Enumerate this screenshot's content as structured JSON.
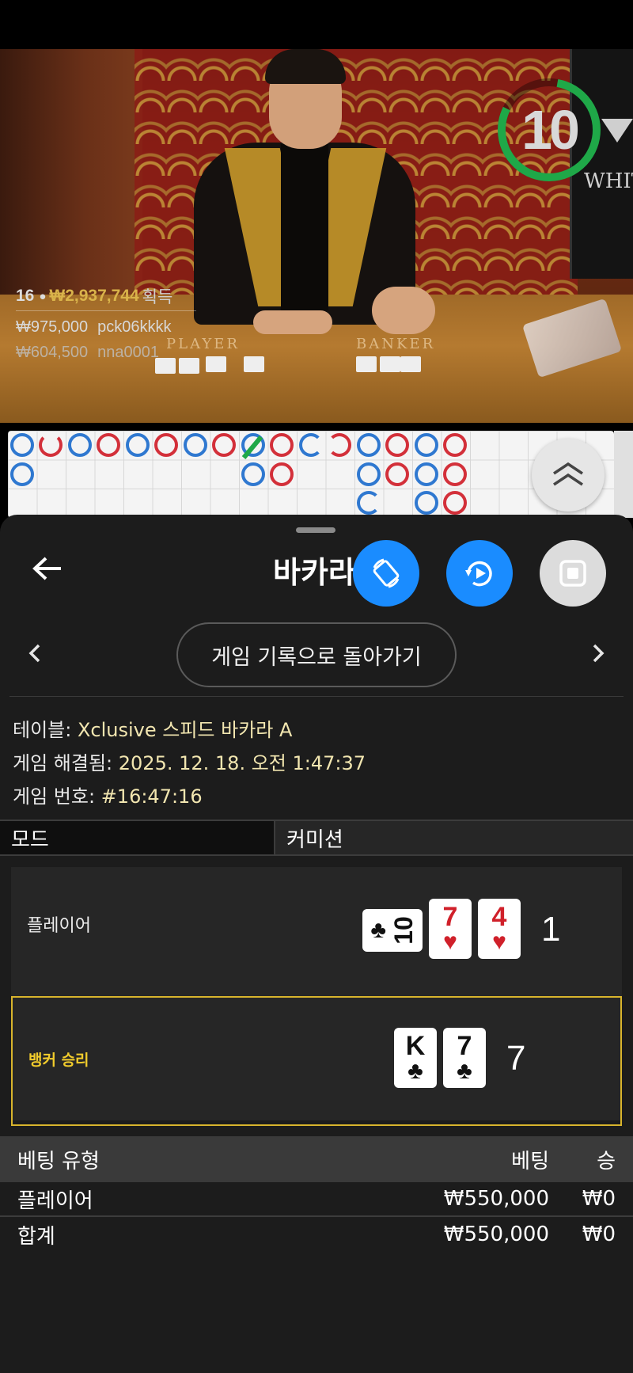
{
  "video": {
    "timer": "10",
    "white_label": "WHIT",
    "felt_player": "PLAYER",
    "felt_banker": "BANKER",
    "winners": {
      "count": "16",
      "total": "₩2,937,744",
      "suffix": "획득",
      "rows": [
        {
          "amount": "₩975,000",
          "user": "pck06kkkk"
        },
        {
          "amount": "₩604,500",
          "user": "nna0001"
        }
      ]
    }
  },
  "sheet": {
    "title": "바카라",
    "return_button": "게임 기록으로 돌아가기",
    "info": {
      "table_label": "테이블:",
      "table_value": "Xclusive 스피드 바카라 A",
      "resolved_label": "게임 해결됨:",
      "resolved_value": "2025. 12. 18. 오전 1:47:37",
      "number_label": "게임 번호:",
      "number_value": "#16:47:16"
    },
    "tabs": {
      "mode": "모드",
      "commission": "커미션"
    },
    "player": {
      "label": "플레이어",
      "cards": [
        {
          "rank": "10",
          "suit": "♣",
          "color": "black"
        },
        {
          "rank": "7",
          "suit": "♥",
          "color": "red"
        },
        {
          "rank": "4",
          "suit": "♥",
          "color": "red"
        }
      ],
      "score": "1"
    },
    "banker": {
      "label": "뱅커 승리",
      "cards": [
        {
          "rank": "K",
          "suit": "♣",
          "color": "black"
        },
        {
          "rank": "7",
          "suit": "♣",
          "color": "black"
        }
      ],
      "score": "7"
    },
    "bets": {
      "headers": {
        "type": "베팅 유형",
        "bet": "베팅",
        "win": "승"
      },
      "rows": [
        {
          "type": "플레이어",
          "bet": "₩550,000",
          "win": "₩0"
        }
      ],
      "total": {
        "type": "합계",
        "bet": "₩550,000",
        "win": "₩0"
      }
    }
  },
  "colors": {
    "player_blue": "#2f78d0",
    "banker_red": "#d3303a",
    "fab_blue": "#1a8cff",
    "gold": "#d8b42c"
  }
}
